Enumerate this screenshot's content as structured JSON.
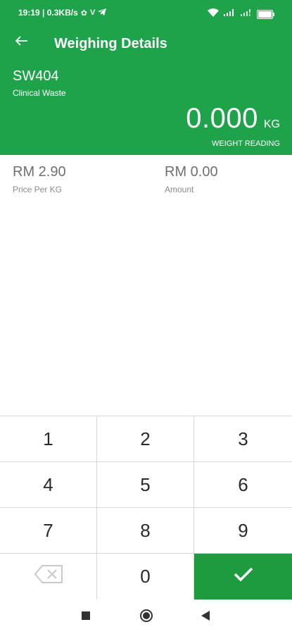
{
  "status_bar": {
    "time_info": "19:19 | 0.3KB/s",
    "battery": "93",
    "icons": [
      "settings-gear-icon",
      "v-app-icon",
      "telegram-icon",
      "wifi-icon",
      "signal-icon",
      "signal-icon",
      "battery-icon"
    ]
  },
  "app_bar": {
    "title": "Weighing Details",
    "back_icon": "arrow-back-icon"
  },
  "header": {
    "code": "SW404",
    "name": "Clinical Waste",
    "weight_value": "0.000",
    "weight_unit": "KG",
    "weight_label": "WEIGHT READING"
  },
  "info": {
    "price_value": "RM 2.90",
    "price_label": "Price Per KG",
    "amount_value": "RM 0.00",
    "amount_label": "Amount"
  },
  "keypad": {
    "keys": [
      "1",
      "2",
      "3",
      "4",
      "5",
      "6",
      "7",
      "8",
      "9",
      "0"
    ],
    "backspace_icon": "backspace-icon",
    "confirm_icon": "check-icon"
  },
  "nav_bar": {
    "icons": [
      "recents-square-icon",
      "home-circle-icon",
      "back-triangle-icon"
    ]
  },
  "colors": {
    "primary_green": "#1ea24a",
    "confirm_green": "#1e9a3f"
  }
}
